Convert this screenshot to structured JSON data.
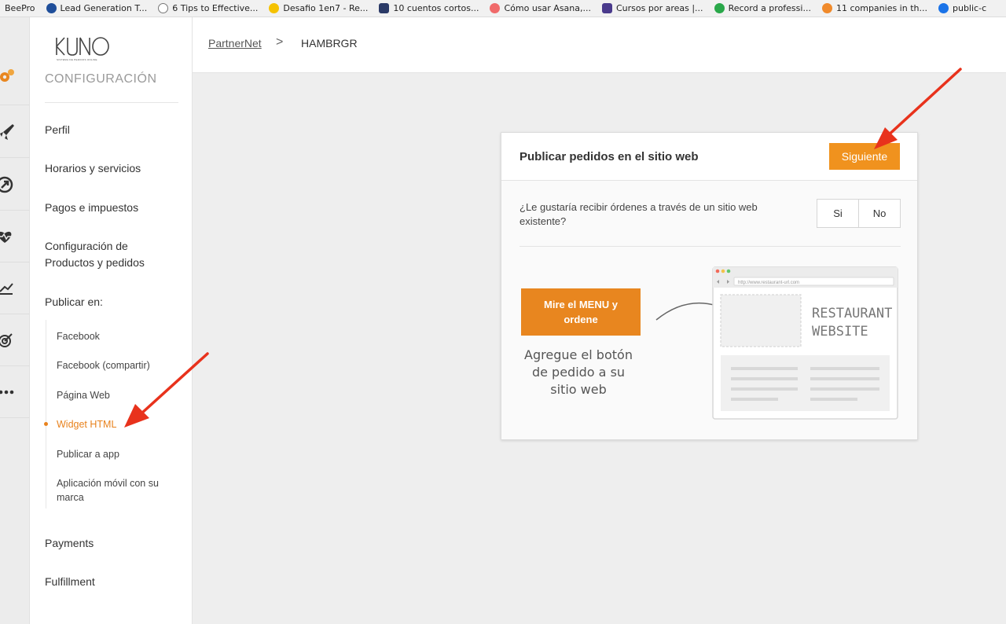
{
  "bookmarks": [
    {
      "label": "BeePro",
      "color": ""
    },
    {
      "label": "Lead Generation T...",
      "color": "#1f4e9a"
    },
    {
      "label": "6 Tips to Effective...",
      "color": "#ffffff"
    },
    {
      "label": "Desafio 1en7 - Re...",
      "color": "#f5c200"
    },
    {
      "label": "10 cuentos cortos...",
      "color": "#2b3a67"
    },
    {
      "label": "Cómo usar Asana,...",
      "color": "#f06a6a"
    },
    {
      "label": "Cursos por areas |...",
      "color": "#4a3a8c"
    },
    {
      "label": "Record a professi...",
      "color": "#2aa84a"
    },
    {
      "label": "11 companies in th...",
      "color": "#f08a2b"
    },
    {
      "label": "public-c",
      "color": "#1a73e8"
    }
  ],
  "sidebar": {
    "logo_text": "KUNO",
    "logo_sub": "SISTEMA DE PEDIDOS ONLINE",
    "section_title": "CONFIGURACIÓN",
    "items": [
      {
        "label": "Perfil"
      },
      {
        "label": "Horarios y servicios"
      },
      {
        "label": "Pagos e impuestos"
      },
      {
        "label": "Configuración de"
      },
      {
        "label": "Productos y pedidos"
      },
      {
        "label": "Publicar en:"
      },
      {
        "label": "Payments"
      },
      {
        "label": "Fulfillment"
      }
    ],
    "subitems": [
      {
        "label": "Facebook"
      },
      {
        "label": "Facebook (compartir)"
      },
      {
        "label": "Página Web"
      },
      {
        "label": "Widget HTML"
      },
      {
        "label": "Publicar a app"
      },
      {
        "label": "Aplicación móvil con su"
      },
      {
        "label": "marca"
      }
    ]
  },
  "icons": [
    "gears-icon",
    "rocket-icon",
    "arrow-circle-icon",
    "heartbeat-icon",
    "chart-icon",
    "target-icon",
    "more-icon"
  ],
  "header": {
    "crumb_link": "PartnerNet",
    "crumb_sep": ">",
    "crumb_current": "HAMBRGR"
  },
  "card": {
    "title": "Publicar pedidos en el sitio web",
    "next_label": "Siguiente",
    "question": "¿Le gustaría recibir órdenes a través de un sitio web existente?",
    "yes_label": "Si",
    "no_label": "No",
    "menu_button": "Mire el MENU y ordene",
    "hand_line1": "Agregue el botón",
    "hand_line2": "de pedido a su",
    "hand_line3": "sitio web",
    "illus_url": "http://www.restaurant-url.com",
    "illus_line1": "RESTAURANT",
    "illus_line2": "WEBSITE"
  },
  "colors": {
    "accent": "#f0921e",
    "arrow": "#e8321c"
  }
}
